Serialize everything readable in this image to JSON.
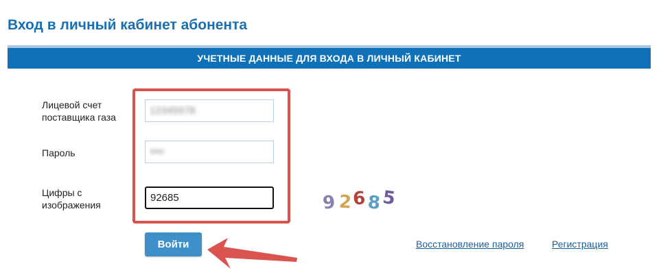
{
  "page": {
    "title": "Вход в личный кабинет абонента"
  },
  "form": {
    "header": "УЧЕТНЫЕ ДАННЫЕ ДЛЯ ВХОДА В ЛИЧНЫЙ КАБИНЕТ",
    "account_label_line1": "Лицевой счет",
    "account_label_line2": "поставщика газа",
    "account_value": "12345678",
    "password_label": "Пароль",
    "password_value": "••••",
    "captcha_label_line1": "Цифры с",
    "captcha_label_line2": "изображения",
    "captcha_value": "92685",
    "captcha_digits": [
      {
        "char": "9",
        "color": "#8a7fb0"
      },
      {
        "char": "2",
        "color": "#d2a650"
      },
      {
        "char": "6",
        "color": "#b0443c"
      },
      {
        "char": "8",
        "color": "#5a9fc6"
      },
      {
        "char": "5",
        "color": "#6d5aa0"
      }
    ],
    "submit_label": "Войти",
    "recover_link": "Восстановление пароля",
    "register_link": "Регистрация"
  },
  "colors": {
    "title": "#1a6fb0",
    "header_bar": "#0f72b8",
    "highlight": "#d9534f",
    "button": "#3f8fc9",
    "link": "#1a5f99"
  }
}
